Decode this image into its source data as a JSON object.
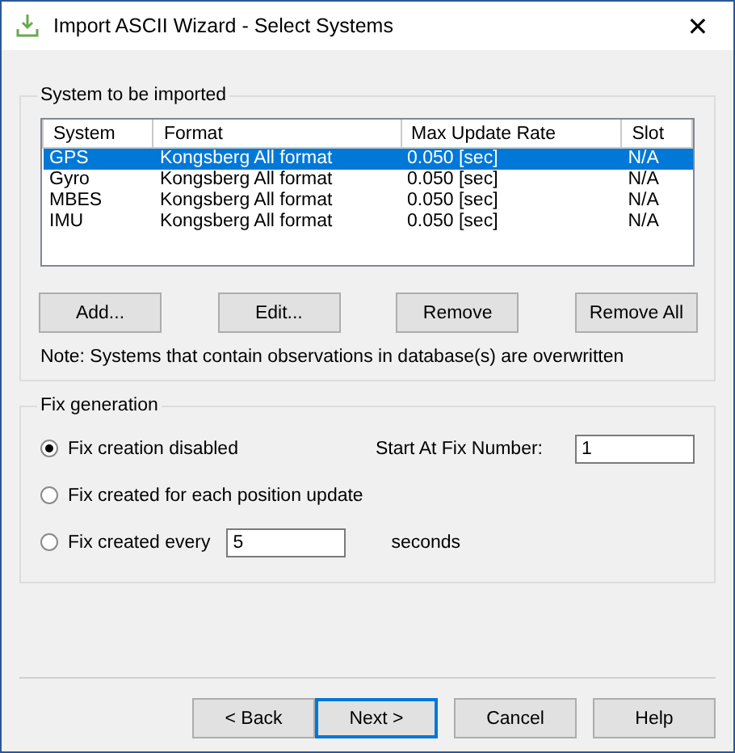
{
  "window": {
    "title": "Import ASCII Wizard - Select Systems",
    "close": "✕"
  },
  "systems_group": {
    "title": "System to be imported",
    "columns": [
      "System",
      "Format",
      "Max Update Rate",
      "Slot"
    ],
    "rows": [
      {
        "cells": [
          "GPS",
          "Kongsberg All format",
          "0.050 [sec]",
          "N/A"
        ],
        "selected": true
      },
      {
        "cells": [
          "Gyro",
          "Kongsberg All format",
          "0.050 [sec]",
          "N/A"
        ],
        "selected": false
      },
      {
        "cells": [
          "MBES",
          "Kongsberg All format",
          "0.050 [sec]",
          "N/A"
        ],
        "selected": false
      },
      {
        "cells": [
          "IMU",
          "Kongsberg All format",
          "0.050 [sec]",
          "N/A"
        ],
        "selected": false
      }
    ],
    "buttons": [
      "Add...",
      "Edit...",
      "Remove",
      "Remove All"
    ],
    "note": "Note: Systems that contain observations in database(s) are overwritten"
  },
  "fix_group": {
    "title": "Fix generation",
    "start_label": "Start At Fix Number:",
    "start_value": "1",
    "options": [
      {
        "label": "Fix creation disabled",
        "selected": true
      },
      {
        "label": "Fix created for each position update",
        "selected": false
      },
      {
        "label": "Fix created every",
        "selected": false
      }
    ],
    "interval_value": "5",
    "interval_unit": "seconds"
  },
  "footer_buttons": [
    {
      "label": "< Back",
      "default": false
    },
    {
      "label": "Next >",
      "default": true
    },
    {
      "label": "Cancel",
      "default": false
    },
    {
      "label": "Help",
      "default": false
    }
  ]
}
